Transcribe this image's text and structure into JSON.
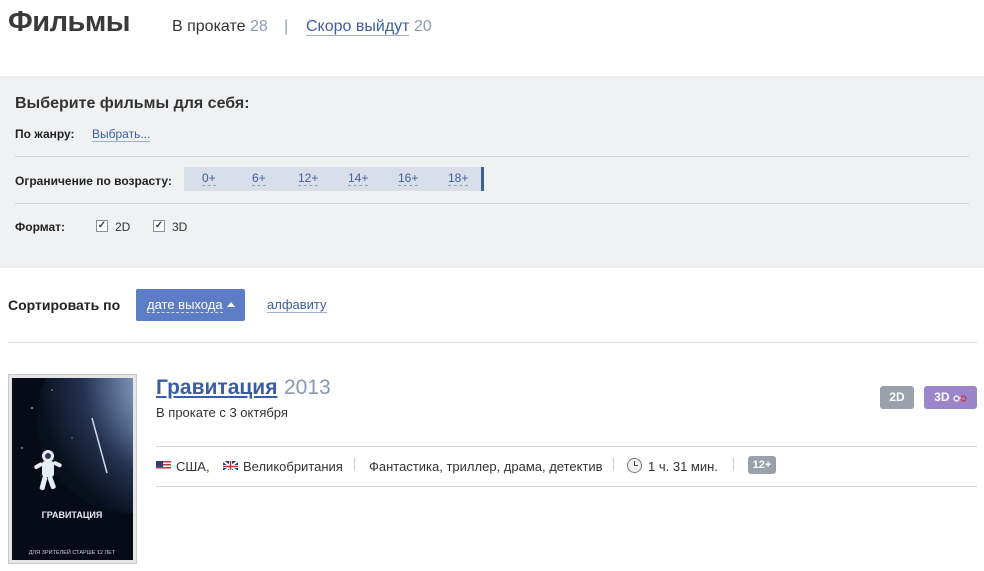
{
  "header": {
    "title": "Фильмы",
    "now_playing_label": "В прокате",
    "now_playing_count": "28",
    "separator": "|",
    "coming_soon_label": "Скоро выйдут",
    "coming_soon_count": "20"
  },
  "filters": {
    "heading": "Выберите фильмы для себя:",
    "genre_label": "По жанру:",
    "genre_link": "Выбрать...",
    "age_label": "Ограничение по возрасту:",
    "age_options": [
      "0+",
      "6+",
      "12+",
      "14+",
      "16+",
      "18+"
    ],
    "format_label": "Формат:",
    "formats": [
      {
        "label": "2D",
        "checked": true
      },
      {
        "label": "3D",
        "checked": true
      }
    ]
  },
  "sort": {
    "label": "Сортировать по",
    "active": "дате выхода",
    "alternative": "алфавиту"
  },
  "movie": {
    "title": "Гравитация",
    "year": "2013",
    "release": "В прокате с 3 октября",
    "badges": [
      "2D",
      "3D"
    ],
    "country_1": "США,",
    "country_2": "Великобритания",
    "genres": "Фантастика, триллер, драма, детектив",
    "duration": "1 ч. 31 мин.",
    "age_rating": "12+",
    "poster_title": "ГРАВИТАЦИЯ",
    "poster_note": "ДЛЯ ЗРИТЕЛЕЙ СТАРШЕ 12 ЛЕТ",
    "colors": {
      "accent": "#5c7cc5",
      "badge_3d": "#9b86cc",
      "badge_gray": "#9aa1aa"
    }
  }
}
